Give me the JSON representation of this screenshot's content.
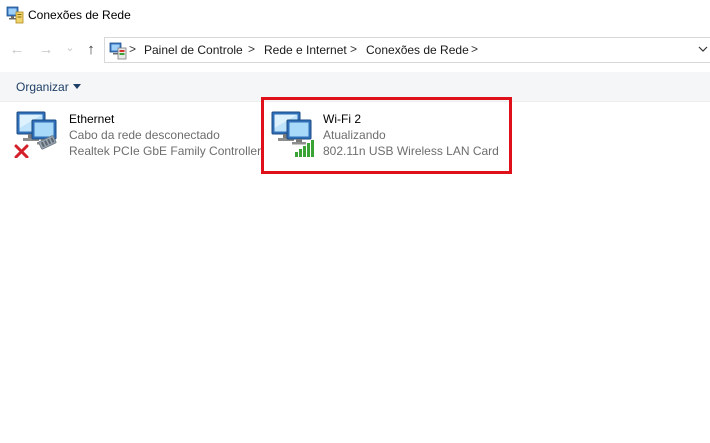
{
  "window": {
    "title": "Conexões de Rede",
    "icon": "network-connections-icon"
  },
  "navigation": {
    "back": "←",
    "forward": "→",
    "recent": "⌄",
    "up": "↑",
    "breadcrumbs": [
      "Painel de Controle",
      "Rede e Internet",
      "Conexões de Rede"
    ],
    "separator": ">"
  },
  "toolbar": {
    "organize_label": "Organizar"
  },
  "connections": [
    {
      "name": "Ethernet",
      "status": "Cabo da rede desconectado",
      "device": "Realtek PCIe GbE Family Controller",
      "icon": "ethernet-disconnected-icon"
    },
    {
      "name": "Wi-Fi 2",
      "status": "Atualizando",
      "device": "802.11n USB Wireless LAN Card",
      "icon": "wifi-signal-icon"
    }
  ],
  "colors": {
    "highlight": "#e0101a",
    "signal": "#3aa335",
    "error": "#d4202a"
  }
}
